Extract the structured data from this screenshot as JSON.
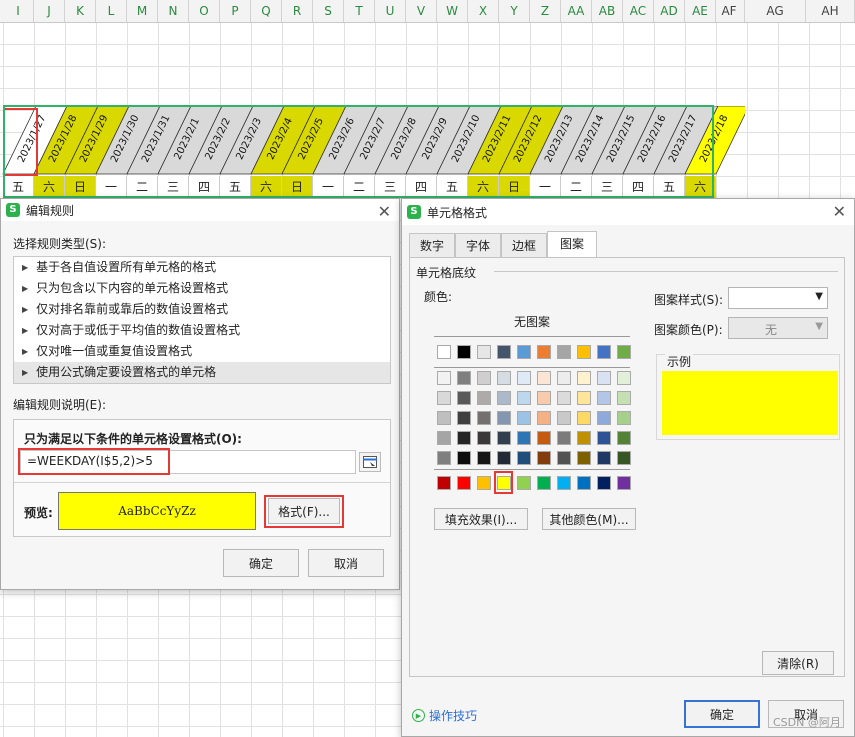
{
  "sheet": {
    "columns": [
      "I",
      "J",
      "K",
      "L",
      "M",
      "N",
      "O",
      "P",
      "Q",
      "R",
      "S",
      "T",
      "U",
      "V",
      "W",
      "X",
      "Y",
      "Z",
      "AA",
      "AB",
      "AC",
      "AD",
      "AE",
      "AF",
      "AG",
      "AH"
    ],
    "dates": [
      "2023/1/27",
      "2023/1/28",
      "2023/1/29",
      "2023/1/30",
      "2023/1/31",
      "2023/2/1",
      "2023/2/2",
      "2023/2/3",
      "2023/2/4",
      "2023/2/5",
      "2023/2/6",
      "2023/2/7",
      "2023/2/8",
      "2023/2/9",
      "2023/2/10",
      "2023/2/11",
      "2023/2/12",
      "2023/2/13",
      "2023/2/14",
      "2023/2/15",
      "2023/2/16",
      "2023/2/17",
      "2023/2/18"
    ],
    "weekdays": [
      "五",
      "六",
      "日",
      "一",
      "二",
      "三",
      "四",
      "五",
      "六",
      "日",
      "一",
      "二",
      "三",
      "四",
      "五",
      "六",
      "日",
      "一",
      "二",
      "三",
      "四",
      "五",
      "六"
    ],
    "weekend_fill": "#d9d900",
    "weekday_fill": "#d9d9d9"
  },
  "rule_dialog": {
    "title": "编辑规则",
    "select_type_label": "选择规则类型(S):",
    "rule_types": [
      "基于各自值设置所有单元格的格式",
      "只为包含以下内容的单元格设置格式",
      "仅对排名靠前或靠后的数值设置格式",
      "仅对高于或低于平均值的数值设置格式",
      "仅对唯一值或重复值设置格式",
      "使用公式确定要设置格式的单元格"
    ],
    "selected_rule_index": 5,
    "edit_desc_label": "编辑规则说明(E):",
    "condition_label": "只为满足以下条件的单元格设置格式(O):",
    "formula": "=WEEKDAY(I$5,2)>5",
    "preview_label": "预览:",
    "preview_text": "AaBbCcYyZz",
    "preview_color": "#ffff00",
    "format_button": "格式(F)...",
    "ok": "确定",
    "cancel": "取消"
  },
  "format_dialog": {
    "title": "单元格格式",
    "tabs": [
      "数字",
      "字体",
      "边框",
      "图案"
    ],
    "active_tab": 3,
    "section_title": "单元格底纹",
    "color_label": "颜色:",
    "no_pattern": "无图案",
    "pattern_style_label": "图案样式(S):",
    "pattern_color_label": "图案颜色(P):",
    "pattern_color_value": "无",
    "sample_label": "示例",
    "sample_color": "#ffff00",
    "fill_effects_button": "填充效果(I)...",
    "more_colors_button": "其他颜色(M)...",
    "clear_button": "清除(R)",
    "tips_link": "操作技巧",
    "ok": "确定",
    "cancel": "取消",
    "palette": {
      "theme_row": [
        "#ffffff",
        "#000000",
        "#e7e6e6",
        "#44546a",
        "#5b9bd5",
        "#ed7d31",
        "#a5a5a5",
        "#ffc000",
        "#4472c4",
        "#70ad47"
      ],
      "shade_rows": [
        [
          "#f2f2f2",
          "#7f7f7f",
          "#d0cece",
          "#d6dce4",
          "#deebf6",
          "#fbe5d5",
          "#ededed",
          "#fff2cc",
          "#d9e2f3",
          "#e2efd9"
        ],
        [
          "#d9d9d9",
          "#595959",
          "#aeaaaa",
          "#acb9ca",
          "#bdd7ee",
          "#f7cbac",
          "#dbdbdb",
          "#fee599",
          "#b4c6e7",
          "#c5e0b3"
        ],
        [
          "#bfbfbf",
          "#3f3f3f",
          "#757070",
          "#8496b0",
          "#9cc3e5",
          "#f4b183",
          "#c9c9c9",
          "#ffd965",
          "#8eaadb",
          "#a8d08d"
        ],
        [
          "#a5a5a5",
          "#262626",
          "#3a3838",
          "#323f4f",
          "#2e75b5",
          "#c55a11",
          "#7b7b7b",
          "#bf9000",
          "#2f5496",
          "#538135"
        ],
        [
          "#7f7f7f",
          "#0d0d0d",
          "#171616",
          "#222a35",
          "#1e4e79",
          "#833c0b",
          "#525252",
          "#7f6000",
          "#1f3864",
          "#375623"
        ]
      ],
      "standard_row": [
        "#c00000",
        "#ff0000",
        "#ffc000",
        "#ffff00",
        "#92d050",
        "#00b050",
        "#00b0f0",
        "#0070c0",
        "#002060",
        "#7030a0"
      ],
      "selected_standard_index": 3
    }
  },
  "watermark": "CSDN @阿月"
}
